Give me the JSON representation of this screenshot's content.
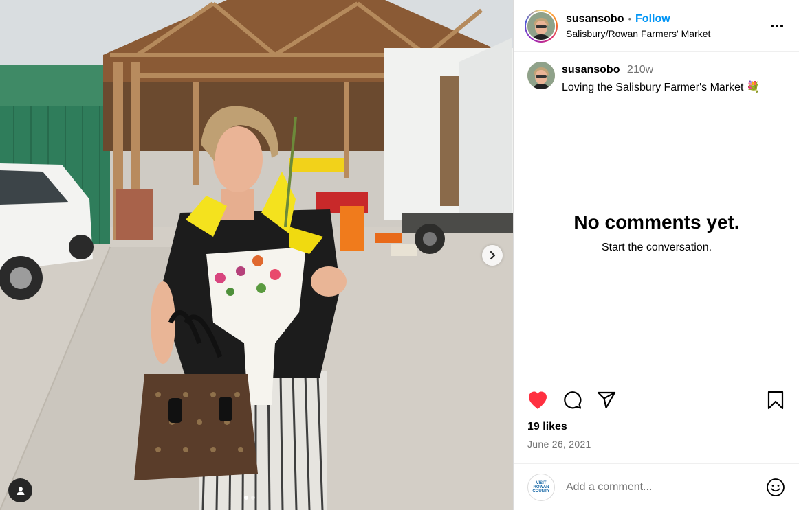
{
  "post": {
    "username": "susansobo",
    "follow_label": "Follow",
    "separator": "•",
    "location": "Salisbury/Rowan Farmers' Market",
    "caption_time": "210w",
    "caption_text": "Loving the Salisbury Farmer's Market 💐"
  },
  "comments": {
    "empty_title": "No comments yet.",
    "empty_subtitle": "Start the conversation."
  },
  "engagement": {
    "likes": "19 likes",
    "date": "June 26, 2021",
    "liked": true
  },
  "comment_box": {
    "placeholder": "Add a comment...",
    "account_logo_lines": [
      "VISIT",
      "ROWAN",
      "COUNTY"
    ]
  },
  "icons": {
    "more": "more-horizontal-icon",
    "like": "heart-filled-icon",
    "comment": "comment-icon",
    "share": "paper-plane-icon",
    "save": "bookmark-icon",
    "emoji": "smiley-icon",
    "next": "chevron-right-icon",
    "tag": "user-tag-icon"
  },
  "colors": {
    "accent": "#0095f6",
    "like": "#ff3040",
    "muted": "#737373"
  }
}
